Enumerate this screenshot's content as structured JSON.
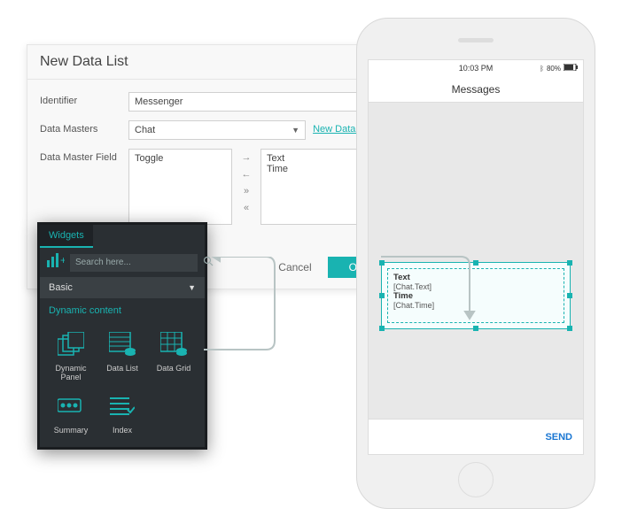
{
  "dialog": {
    "title": "New Data List",
    "identifier_label": "Identifier",
    "identifier_value": "Messenger",
    "datamasters_label": "Data Masters",
    "datamasters_value": "Chat",
    "new_dm_link": "New Datamaster",
    "field_label": "Data Master Field",
    "left_list": [
      "Toggle"
    ],
    "right_list": [
      "Text",
      "Time"
    ],
    "cancel": "Cancel",
    "ok": "OK"
  },
  "widgets": {
    "tab": "Widgets",
    "search_placeholder": "Search here...",
    "category": "Basic",
    "section": "Dynamic content",
    "items": [
      {
        "label": "Dynamic Panel"
      },
      {
        "label": "Data List"
      },
      {
        "label": "Data Grid"
      },
      {
        "label": "Summary"
      },
      {
        "label": "Index"
      }
    ]
  },
  "phone": {
    "time": "10:03 PM",
    "battery": "80%",
    "title": "Messages",
    "cell": {
      "f1_label": "Text",
      "f1_bind": "[Chat.Text]",
      "f2_label": "Time",
      "f2_bind": "[Chat.Time]"
    },
    "send": "SEND"
  }
}
